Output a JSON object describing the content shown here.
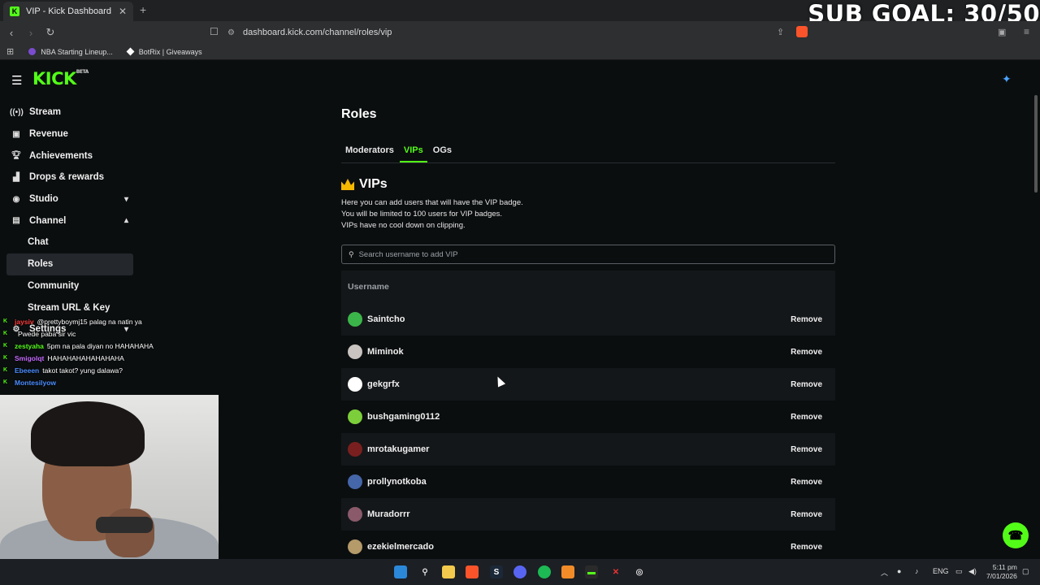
{
  "browser": {
    "tab_title": "VIP - Kick Dashboard",
    "tab_favicon": "K",
    "url": "dashboard.kick.com/channel/roles/vip",
    "bookmarks": [
      "NBA Starting Lineup...",
      "BotRix | Giveaways"
    ]
  },
  "overlay": {
    "sub_goal": "SUB GOAL: 30/50"
  },
  "header": {
    "logo": "KICK",
    "logo_tag": "BETA"
  },
  "sidebar": {
    "items": [
      {
        "label": "Stream",
        "icon": "broadcast-icon"
      },
      {
        "label": "Revenue",
        "icon": "money-icon"
      },
      {
        "label": "Achievements",
        "icon": "trophy-icon"
      },
      {
        "label": "Drops & rewards",
        "icon": "gift-icon"
      },
      {
        "label": "Studio",
        "icon": "studio-icon"
      },
      {
        "label": "Channel",
        "icon": "channel-icon"
      },
      {
        "label": "Chat"
      },
      {
        "label": "Roles"
      },
      {
        "label": "Community"
      },
      {
        "label": "Stream URL & Key"
      },
      {
        "label": "Settings",
        "icon": "gear-icon"
      }
    ]
  },
  "main": {
    "title": "Roles",
    "tabs": [
      "Moderators",
      "VIPs",
      "OGs"
    ],
    "active_tab": "VIPs",
    "section_title": "VIPs",
    "desc_lines": [
      "Here you can add users that will have the VIP badge.",
      "You will be limited to 100 users for VIP badges.",
      "VIPs have no cool down on clipping."
    ],
    "search_placeholder": "Search username to add VIP",
    "table_header": "Username",
    "remove_label": "Remove",
    "users": [
      {
        "name": "Saintcho",
        "color": "#3bb54a"
      },
      {
        "name": "Miminok",
        "color": "#c9c4c0"
      },
      {
        "name": "gekgrfx",
        "color": "#ffffff"
      },
      {
        "name": "bushgaming0112",
        "color": "#7ccf3a"
      },
      {
        "name": "mrotakugamer",
        "color": "#7a1f1f"
      },
      {
        "name": "prollynotkoba",
        "color": "#4566a8"
      },
      {
        "name": "Muradorrr",
        "color": "#8a5a6a"
      },
      {
        "name": "ezekielmercado",
        "color": "#b59a6a"
      }
    ]
  },
  "chat": [
    {
      "name": "jaysiv",
      "text": "@prettyboymj15 palag na natin ya",
      "color": "#ff3b3b"
    },
    {
      "name": "",
      "text": "Pwede paba sir vic",
      "color": "#ff3b3b"
    },
    {
      "name": "zestyaha",
      "text": "5pm na pala diyan no HAHAHAHA",
      "color": "#53fc18"
    },
    {
      "name": "Smigolqt",
      "text": "HAHAHAHAHAHAHAHA",
      "color": "#c56bff"
    },
    {
      "name": "Ebeeen",
      "text": "takot takot? yung dalawa?",
      "color": "#4a8cff"
    },
    {
      "name": "Montesilyow",
      "text": "",
      "color": "#4a8cff"
    }
  ],
  "taskbar": {
    "lang": "ENG",
    "time": "5:11 pm",
    "date": "7/01/2026"
  },
  "colors": {
    "accent": "#53fc18",
    "bg": "#0b0e0f",
    "row": "#141719"
  }
}
